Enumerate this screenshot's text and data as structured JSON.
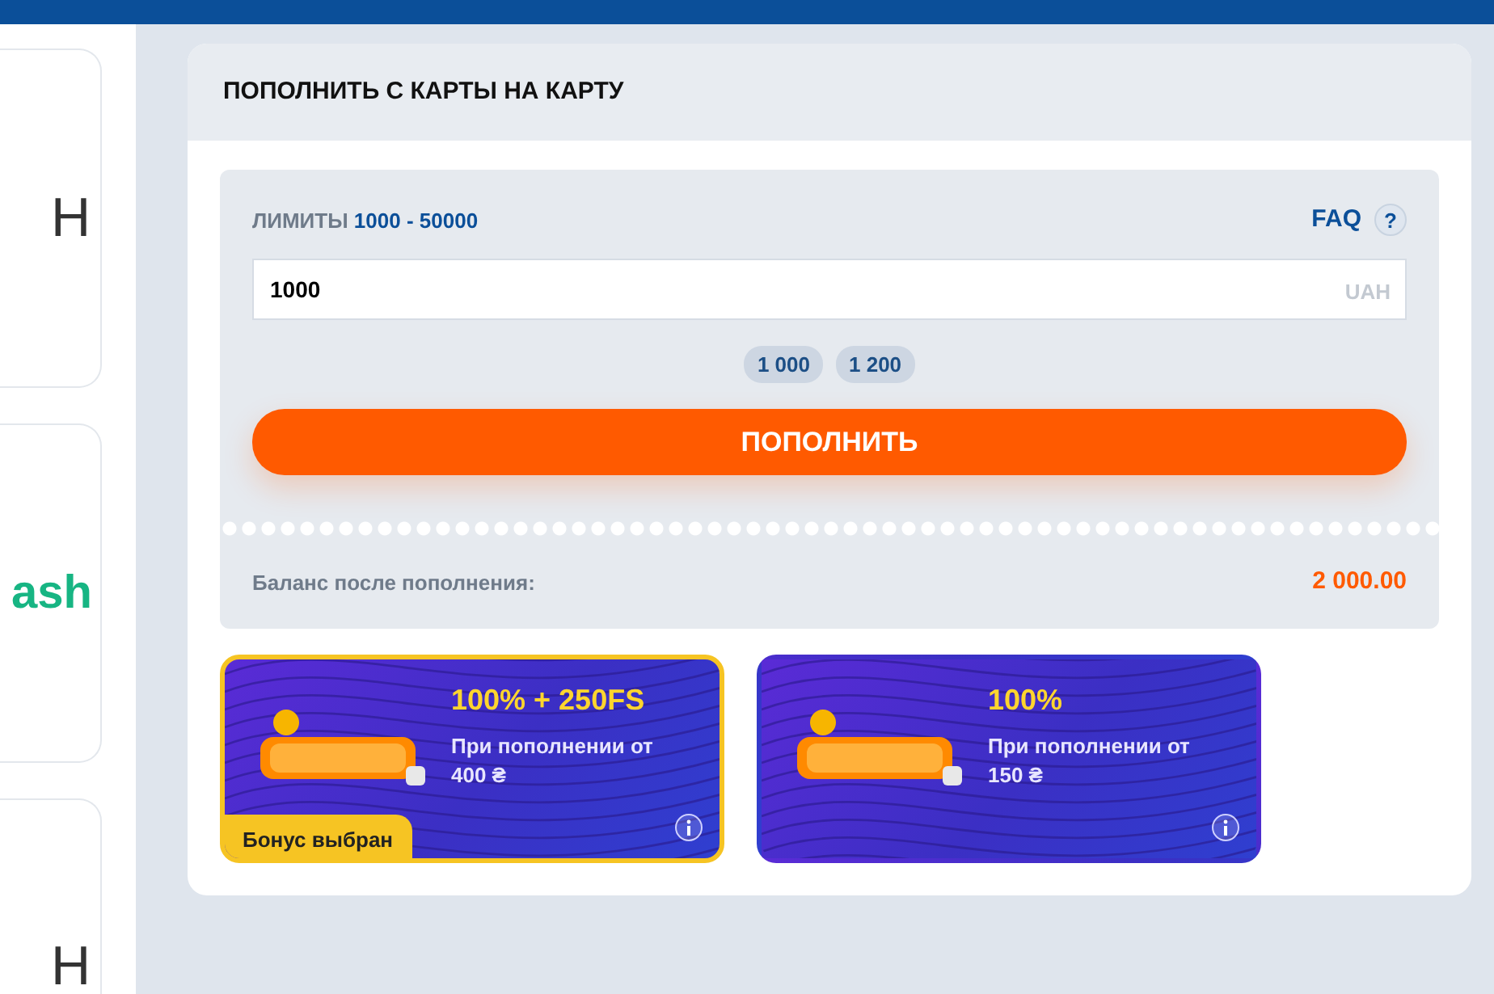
{
  "side_cards": [
    {
      "text": "Н",
      "kind": "plain"
    },
    {
      "text": "ash",
      "kind": "brand"
    },
    {
      "text": "Н",
      "kind": "plain"
    }
  ],
  "panel": {
    "title": "ПОПОЛНИТЬ С КАРТЫ НА КАРТУ",
    "limits_label": "ЛИМИТЫ",
    "limits_value": "1000 - 50000",
    "faq": "FAQ",
    "help": "?",
    "amount": {
      "value": "1000",
      "currency": "UAH"
    },
    "quick_amounts": [
      "1 000",
      "1 200"
    ],
    "submit": "ПОПОЛНИТЬ",
    "balance_label": "Баланс после пополнения:",
    "balance_value": "2 000.00"
  },
  "bonuses": [
    {
      "title": "100% + 250FS",
      "description": "При пополнении от 400 ₴",
      "selected": true
    },
    {
      "title": "100%",
      "description": "При пополнении от 150 ₴",
      "selected": false
    }
  ],
  "selected_badge": "Бонус выбран"
}
